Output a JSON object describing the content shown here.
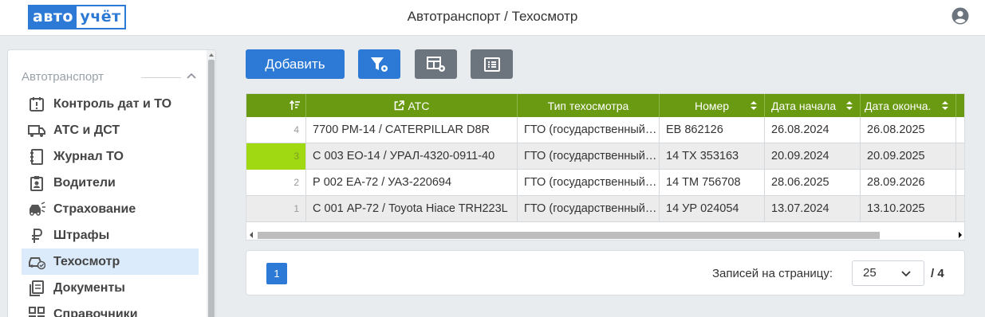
{
  "app": {
    "logo_left": "авто",
    "logo_right": "учёт",
    "title": "Автотранспорт / Техосмотр"
  },
  "sidebar": {
    "section": "Автотранспорт",
    "items": [
      {
        "label": "Контроль дат и ТО",
        "icon": "calendar-alert-icon"
      },
      {
        "label": "АТС и ДСТ",
        "icon": "truck-icon"
      },
      {
        "label": "Журнал ТО",
        "icon": "logbook-icon"
      },
      {
        "label": "Водители",
        "icon": "driver-badge-icon"
      },
      {
        "label": "Страхование",
        "icon": "car-crash-icon"
      },
      {
        "label": "Штрафы",
        "icon": "ruble-icon"
      },
      {
        "label": "Техосмотр",
        "icon": "car-check-icon",
        "active": true
      },
      {
        "label": "Документы",
        "icon": "documents-icon"
      },
      {
        "label": "Справочники",
        "icon": "grid-icon"
      }
    ]
  },
  "toolbar": {
    "add_label": "Добавить",
    "filter_icon": "filter-settings-icon",
    "columns_icon": "table-settings-icon",
    "list_icon": "list-icon"
  },
  "table": {
    "columns": [
      "",
      "АТС",
      "Тип техосмотра",
      "Номер",
      "Дата начала",
      "Дата оконча."
    ],
    "rows": [
      {
        "n": "4",
        "ats": "7700 РМ-14 / CATERPILLAR D8R",
        "type": "ГТО (государственный технический осмотр)",
        "number": "ЕВ 862126",
        "start": "26.08.2024",
        "end": "26.08.2025"
      },
      {
        "n": "3",
        "ats": "С 003 ЕО-14 / УРАЛ-4320-0911-40",
        "type": "ГТО (государственный технический осмотр)",
        "number": "14 ТХ 353163",
        "start": "20.09.2024",
        "end": "20.09.2025"
      },
      {
        "n": "2",
        "ats": "Р 002 ЕА-72 / УАЗ-220694",
        "type": "ГТО (государственный технический осмотр)",
        "number": "14 ТМ 756708",
        "start": "28.06.2025",
        "end": "28.09.2026"
      },
      {
        "n": "1",
        "ats": "С 001 АР-72 / Toyota Hiace TRH223L",
        "type": "ГТО (государственный технический осмотр)",
        "number": "14 УР 024054",
        "start": "13.07.2024",
        "end": "13.10.2025"
      }
    ]
  },
  "pager": {
    "page": "1",
    "per_page_label": "Записей на страницу:",
    "per_page": "25",
    "total": "/ 4"
  },
  "colors": {
    "accent": "#2d7ad6",
    "header_green": "#6a9a12",
    "highlight": "#a0d911"
  }
}
